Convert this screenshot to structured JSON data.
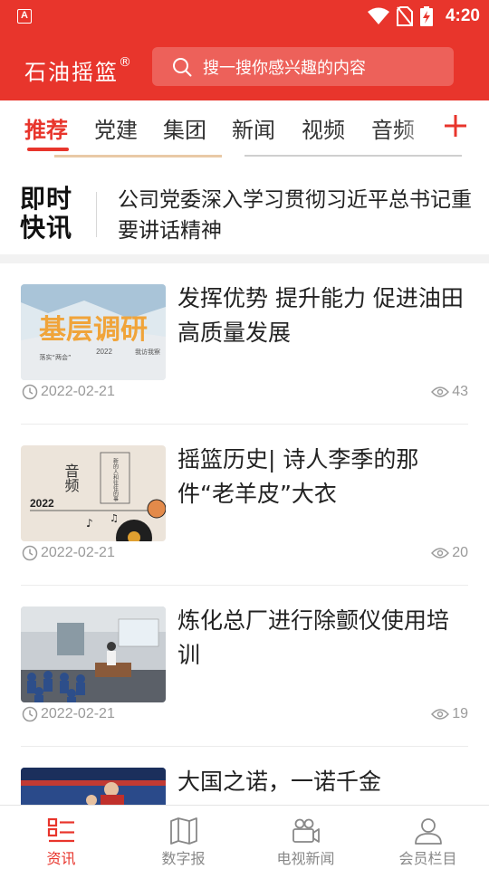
{
  "status_bar": {
    "app_icon_letter": "A",
    "time": "4:20"
  },
  "header": {
    "app_title": "石油摇篮",
    "registered_mark": "®",
    "search_placeholder": "搜一搜你感兴趣的内容"
  },
  "tabs": [
    {
      "label": "推荐",
      "active": true
    },
    {
      "label": "党建",
      "active": false
    },
    {
      "label": "集团",
      "active": false
    },
    {
      "label": "新闻",
      "active": false
    },
    {
      "label": "视频",
      "active": false
    },
    {
      "label": "音频",
      "active": false
    }
  ],
  "flash_news": {
    "logo_line1": "即时",
    "logo_line2": "快讯",
    "headline": "公司党委深入学习贯彻习近平总书记重要讲话精神"
  },
  "news": [
    {
      "title": "发挥优势 提升能力 促进油田高质量发展",
      "date": "2022-02-21",
      "views": "43",
      "thumb": {
        "big_text": "基层调研",
        "small_left": "落实“两会”",
        "small_mid": "2022",
        "small_right": "我访我察"
      }
    },
    {
      "title": "摇篮历史| 诗人李季的那件“老羊皮”大衣",
      "date": "2022-02-21",
      "views": "20",
      "thumb": {
        "big_text": "音频",
        "year": "2022",
        "side_text": "新的人和往往的事"
      }
    },
    {
      "title": "炼化总厂进行除颤仪使用培训",
      "date": "2022-02-21",
      "views": "19",
      "thumb": {}
    },
    {
      "title": "大国之诺，一诺千金",
      "date": "",
      "views": "",
      "thumb": {}
    }
  ],
  "bottom_nav": [
    {
      "label": "资讯",
      "icon": "news-list-icon",
      "active": true
    },
    {
      "label": "数字报",
      "icon": "newspaper-icon",
      "active": false
    },
    {
      "label": "电视新闻",
      "icon": "video-camera-icon",
      "active": false
    },
    {
      "label": "会员栏目",
      "icon": "user-icon",
      "active": false
    }
  ],
  "colors": {
    "brand_red": "#e8352c",
    "muted_gray": "#9a9a9a"
  }
}
